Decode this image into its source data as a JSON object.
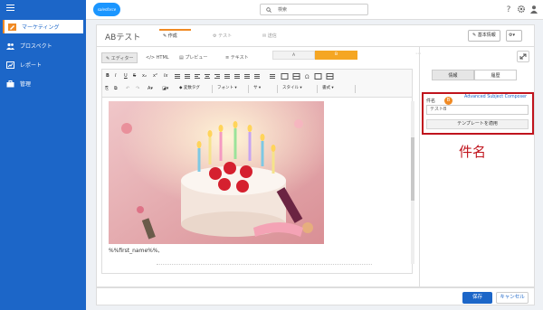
{
  "brand": {
    "logo_text": "salesforce pardot",
    "accent": "#1c66c8",
    "highlight": "#f08a24",
    "callout": "#c0141d"
  },
  "sidebar": {
    "items": [
      {
        "label": "マーケティング",
        "icon": "pencil-icon",
        "active": true
      },
      {
        "label": "プロスペクト",
        "icon": "people-icon",
        "active": false
      },
      {
        "label": "レポート",
        "icon": "chart-icon",
        "active": false
      },
      {
        "label": "管理",
        "icon": "briefcase-icon",
        "active": false
      }
    ]
  },
  "topbar": {
    "search_placeholder": "検索",
    "icons": [
      "help-icon",
      "gear-icon",
      "user-icon"
    ]
  },
  "header": {
    "title": "ABテスト",
    "tabs": [
      {
        "label": "作成",
        "icon": "edit-icon",
        "active": true
      },
      {
        "label": "テスト",
        "icon": "gear-icon"
      },
      {
        "label": "送信",
        "icon": "send-icon"
      }
    ],
    "basic_info_button": "基本情報"
  },
  "editor_tabs": [
    {
      "label": "エディター",
      "icon": "edit-icon",
      "active": true
    },
    {
      "label": "HTML",
      "icon": "code-icon"
    },
    {
      "label": "プレビュー",
      "icon": "document-icon"
    },
    {
      "label": "テキスト",
      "icon": "text-icon"
    }
  ],
  "variants": {
    "a": "A",
    "b": "B",
    "selected": "B"
  },
  "toolbar": {
    "row1": [
      "B",
      "I",
      "U",
      "S",
      "x₂",
      "x²",
      "Ix"
    ],
    "row2_labels": {
      "variable_tag": "変数タグ",
      "font": "フォント",
      "size": "サ",
      "style": "スタイル",
      "format": "書式"
    }
  },
  "editor_body": {
    "greeting": "%%first_name%%,"
  },
  "right_panel": {
    "tabs": [
      {
        "label": "情報",
        "active": true
      },
      {
        "label": "履歴",
        "active": false
      }
    ],
    "subject_label": "件名",
    "subject_badge": "B",
    "advanced_link": "Advanced Subject Composer",
    "subject_value": "テストB",
    "apply_template_button": "テンプレートを適用",
    "callout_text": "件名"
  },
  "footer": {
    "save": "保存",
    "cancel": "キャンセル"
  }
}
